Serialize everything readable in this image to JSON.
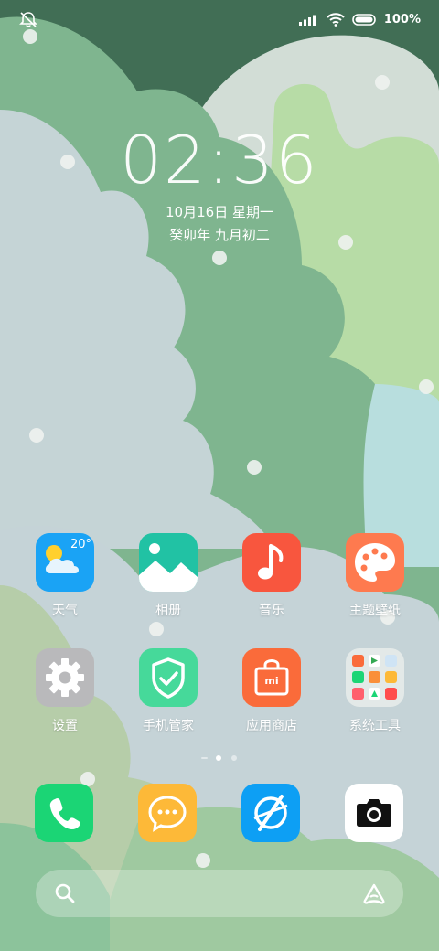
{
  "status_bar": {
    "battery_text": "100%",
    "icons": [
      "mute-icon",
      "signal-icon",
      "wifi-icon",
      "battery-icon"
    ]
  },
  "lockscreen": {
    "time": "02:36",
    "date_line1": "10月16日 星期一",
    "date_line2": "癸卯年 九月初二"
  },
  "apps_row1": [
    {
      "label": "天气",
      "icon": "weather-icon",
      "temp": "20°"
    },
    {
      "label": "相册",
      "icon": "gallery-icon"
    },
    {
      "label": "音乐",
      "icon": "music-icon"
    },
    {
      "label": "主题壁纸",
      "icon": "themes-icon"
    }
  ],
  "apps_row2": [
    {
      "label": "设置",
      "icon": "settings-icon"
    },
    {
      "label": "手机管家",
      "icon": "security-icon"
    },
    {
      "label": "应用商店",
      "icon": "app-store-icon",
      "badge": "mi"
    },
    {
      "label": "系统工具",
      "icon": "folder-icon"
    }
  ],
  "dock": [
    "phone-icon",
    "messages-icon",
    "browser-icon",
    "camera-icon"
  ],
  "page_indicator": {
    "pages": 2,
    "current": 1
  },
  "colors": {
    "weather": "#1aa3f5",
    "gallery": "#21c2a4",
    "music": "#f8563e",
    "themes": "#fe7a4f",
    "settings": "#b9b9bb",
    "security": "#46d99a",
    "app_store": "#fa6b3a",
    "phone": "#1bd575",
    "messages": "#fdb938",
    "browser": "#0d9ff4",
    "camera": "#ffffff"
  }
}
